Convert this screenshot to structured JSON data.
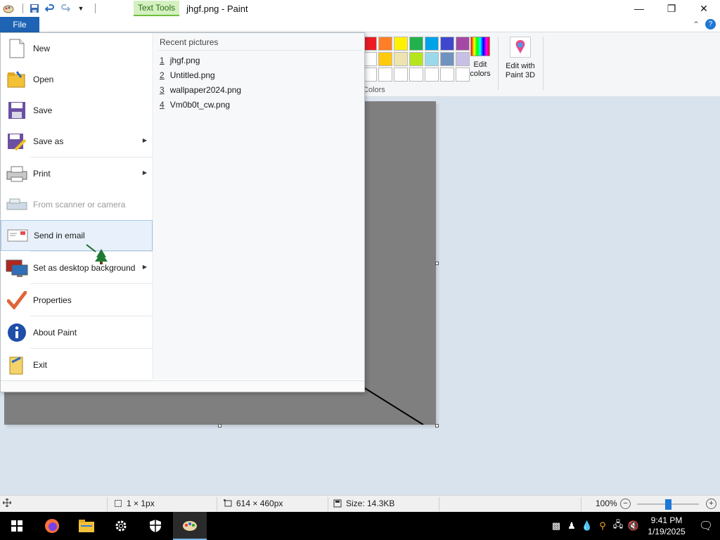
{
  "window": {
    "title": "jhgf.png - Paint",
    "context_tab": "Text Tools"
  },
  "ribbon": {
    "file_tab": "File",
    "colors_label": "Colors",
    "edit_colors": "Edit colors",
    "edit_with_paint3d": "Edit with Paint 3D",
    "palette_row1": [
      "#ed1c24",
      "#ff7f27",
      "#fff200",
      "#22b14c",
      "#00a2e8",
      "#3f48cc",
      "#a349a4"
    ],
    "palette_row2": [
      "#ffffff",
      "#ffc90e",
      "#efe4b0",
      "#b5e61d",
      "#99d9ea",
      "#7092be",
      "#c8bfe7"
    ],
    "palette_row3": [
      "#ffffff",
      "#ffffff",
      "#ffffff",
      "#ffffff",
      "#ffffff",
      "#ffffff",
      "#ffffff"
    ]
  },
  "file_menu": {
    "items": [
      {
        "label": "New",
        "icon": "new-file-icon",
        "submenu": false,
        "disabled": false
      },
      {
        "label": "Open",
        "icon": "open-folder-icon",
        "submenu": false,
        "disabled": false
      },
      {
        "label": "Save",
        "icon": "save-disk-icon",
        "submenu": false,
        "disabled": false
      },
      {
        "label": "Save as",
        "icon": "save-as-icon",
        "submenu": true,
        "disabled": false
      },
      {
        "label": "Print",
        "icon": "printer-icon",
        "submenu": true,
        "disabled": false
      },
      {
        "label": "From scanner or camera",
        "icon": "scanner-icon",
        "submenu": false,
        "disabled": true
      },
      {
        "label": "Send in email",
        "icon": "email-icon",
        "submenu": false,
        "disabled": false
      },
      {
        "label": "Set as desktop background",
        "icon": "desktop-background-icon",
        "submenu": true,
        "disabled": false
      },
      {
        "label": "Properties",
        "icon": "properties-check-icon",
        "submenu": false,
        "disabled": false
      },
      {
        "label": "About Paint",
        "icon": "info-icon",
        "submenu": false,
        "disabled": false
      },
      {
        "label": "Exit",
        "icon": "exit-icon",
        "submenu": false,
        "disabled": false
      }
    ],
    "recent_title": "Recent pictures",
    "recent": [
      {
        "num": "1",
        "name": "jhgf.png"
      },
      {
        "num": "2",
        "name": "Untitled.png"
      },
      {
        "num": "3",
        "name": "wallpaper2024.png"
      },
      {
        "num": "4",
        "name": "Vm0b0t_cw.png"
      }
    ]
  },
  "status": {
    "selection": "1 × 1px",
    "canvas_size": "614 × 460px",
    "file_size": "Size: 14.3KB",
    "zoom": "100%",
    "zoom_level_percent": 100
  },
  "taskbar": {
    "time": "9:41 PM",
    "date": "1/19/2025",
    "apps": [
      "start-icon",
      "firefox-icon",
      "file-explorer-icon",
      "settings-icon",
      "security-icon",
      "paint-icon"
    ]
  }
}
